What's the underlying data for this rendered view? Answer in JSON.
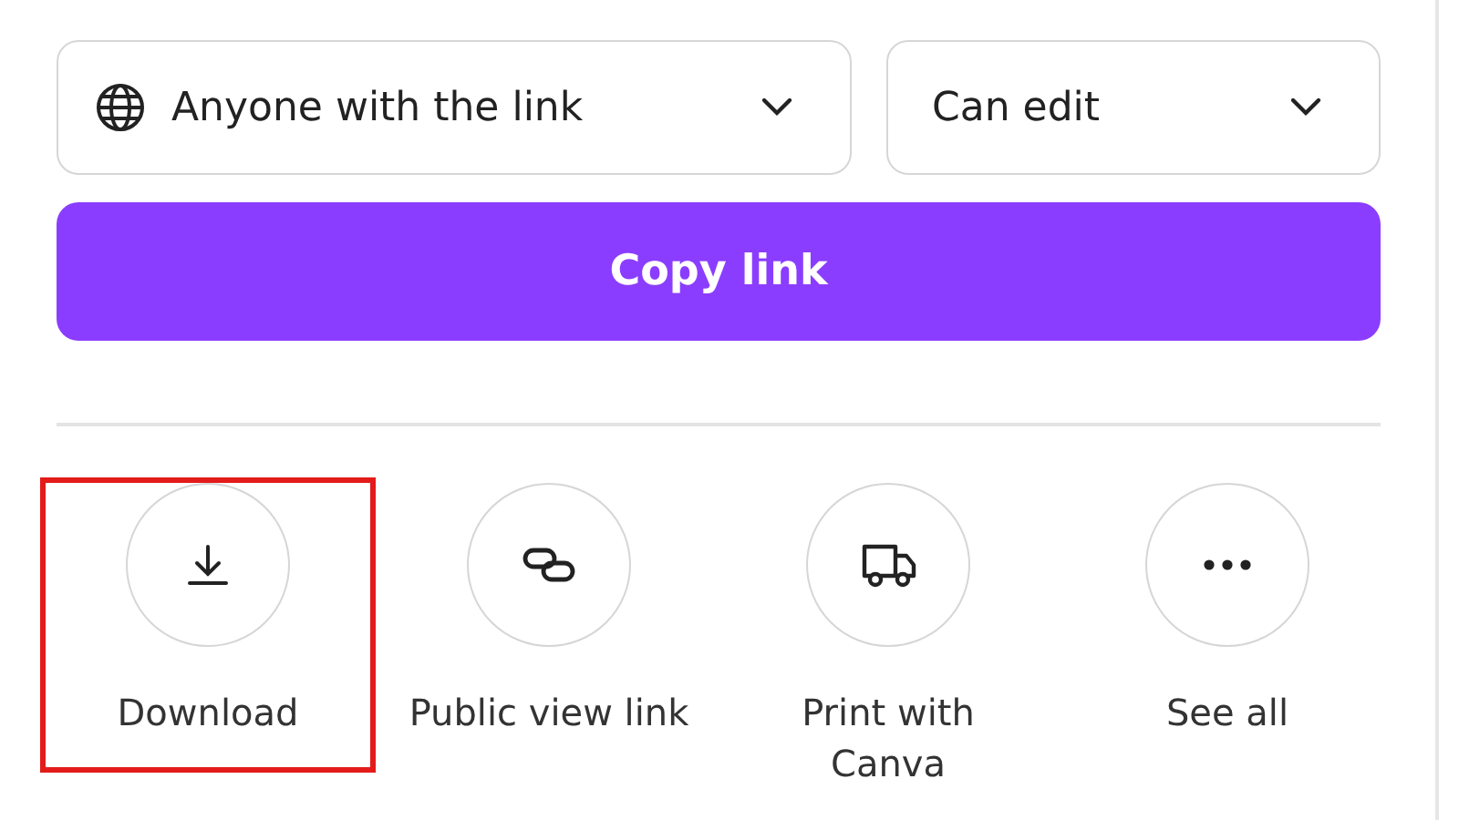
{
  "access": {
    "value": "Anyone with the link"
  },
  "permission": {
    "value": "Can edit"
  },
  "copy_button": {
    "label": "Copy link"
  },
  "actions": [
    {
      "kind": "download",
      "label": "Download",
      "highlighted": true
    },
    {
      "kind": "link",
      "label": "Public view link",
      "highlighted": false
    },
    {
      "kind": "print",
      "label": "Print with Canva",
      "highlighted": false
    },
    {
      "kind": "more",
      "label": "See all",
      "highlighted": false
    }
  ]
}
